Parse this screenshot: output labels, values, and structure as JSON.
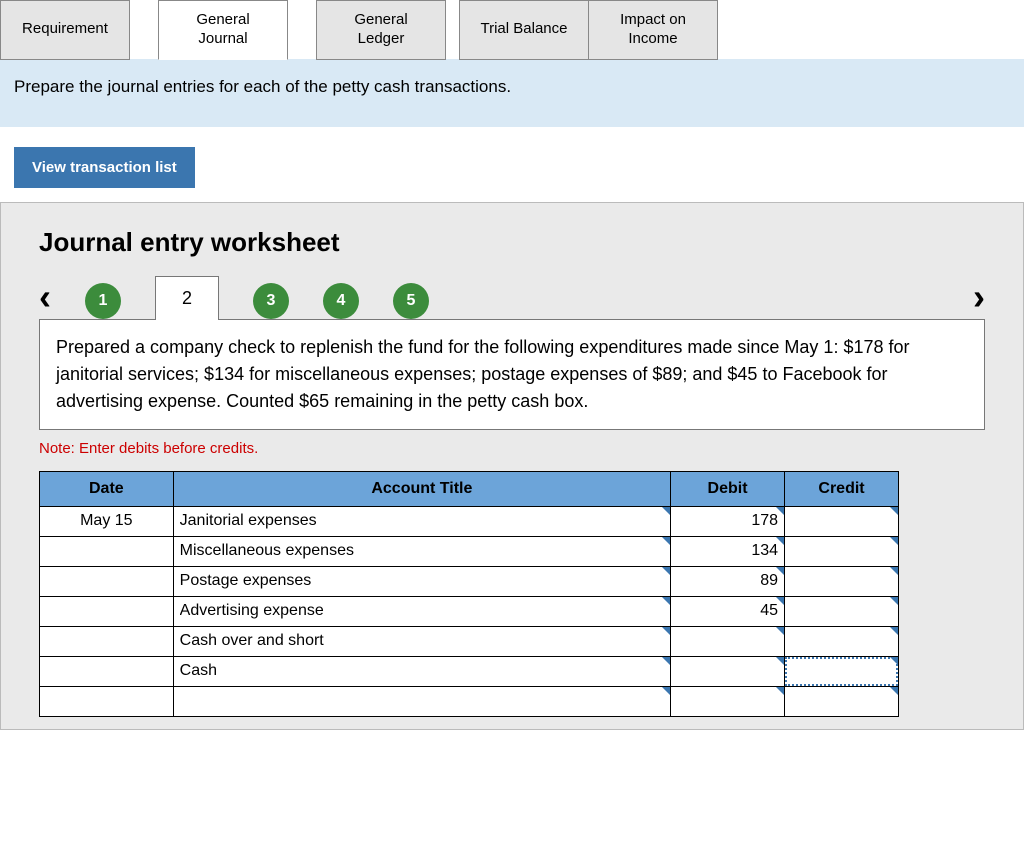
{
  "tabs": {
    "requirement": "Requirement",
    "general_journal": "General\nJournal",
    "general_ledger": "General\nLedger",
    "trial_balance": "Trial Balance",
    "impact_income": "Impact on\nIncome"
  },
  "instruction": "Prepare the journal entries for each of the petty cash transactions.",
  "view_transaction_list": "View transaction list",
  "worksheet_title": "Journal entry worksheet",
  "steps": [
    "1",
    "2",
    "3",
    "4",
    "5"
  ],
  "active_step": "2",
  "description": "Prepared a company check to replenish the fund for the following expenditures made since May 1: $178 for janitorial services; $134 for miscellaneous expenses; postage expenses of $89; and $45 to Facebook for advertising expense. Counted $65 remaining in the petty cash box.",
  "note": "Note: Enter debits before credits.",
  "headers": {
    "date": "Date",
    "account": "Account Title",
    "debit": "Debit",
    "credit": "Credit"
  },
  "rows": [
    {
      "date": "May 15",
      "account": "Janitorial expenses",
      "debit": "178",
      "credit": ""
    },
    {
      "date": "",
      "account": "Miscellaneous expenses",
      "debit": "134",
      "credit": ""
    },
    {
      "date": "",
      "account": "Postage expenses",
      "debit": "89",
      "credit": ""
    },
    {
      "date": "",
      "account": "Advertising expense",
      "debit": "45",
      "credit": ""
    },
    {
      "date": "",
      "account": "Cash over and short",
      "debit": "",
      "credit": ""
    },
    {
      "date": "",
      "account": "Cash",
      "debit": "",
      "credit": ""
    },
    {
      "date": "",
      "account": "",
      "debit": "",
      "credit": ""
    }
  ],
  "focused_cell": {
    "row": 5,
    "col": "credit"
  }
}
